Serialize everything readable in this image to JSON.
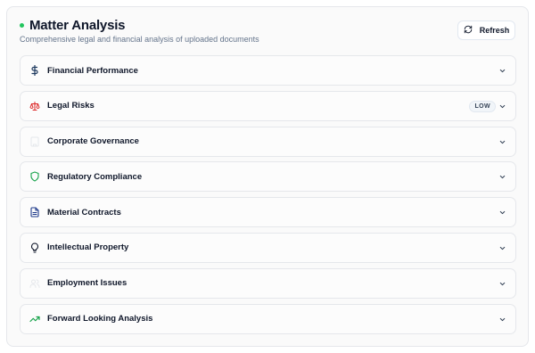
{
  "header": {
    "title": "Matter Analysis",
    "subtitle": "Comprehensive legal and financial analysis of uploaded documents",
    "status_color": "#22c55e",
    "refresh_label": "Refresh"
  },
  "sections": [
    {
      "label": "Financial Performance",
      "icon": "dollar-sign-icon",
      "icon_color": "#1e3a5f",
      "badge": ""
    },
    {
      "label": "Legal Risks",
      "icon": "scales-icon",
      "icon_color": "#dc2626",
      "badge": "LOW"
    },
    {
      "label": "Corporate Governance",
      "icon": "building-icon",
      "icon_color": "#e5e7eb",
      "badge": ""
    },
    {
      "label": "Regulatory Compliance",
      "icon": "shield-icon",
      "icon_color": "#16a34a",
      "badge": ""
    },
    {
      "label": "Material Contracts",
      "icon": "document-icon",
      "icon_color": "#1e3a8a",
      "badge": ""
    },
    {
      "label": "Intellectual Property",
      "icon": "lightbulb-icon",
      "icon_color": "#0f172a",
      "badge": ""
    },
    {
      "label": "Employment Issues",
      "icon": "users-icon",
      "icon_color": "#e5e7eb",
      "badge": ""
    },
    {
      "label": "Forward Looking Analysis",
      "icon": "trending-up-icon",
      "icon_color": "#16a34a",
      "badge": ""
    }
  ]
}
